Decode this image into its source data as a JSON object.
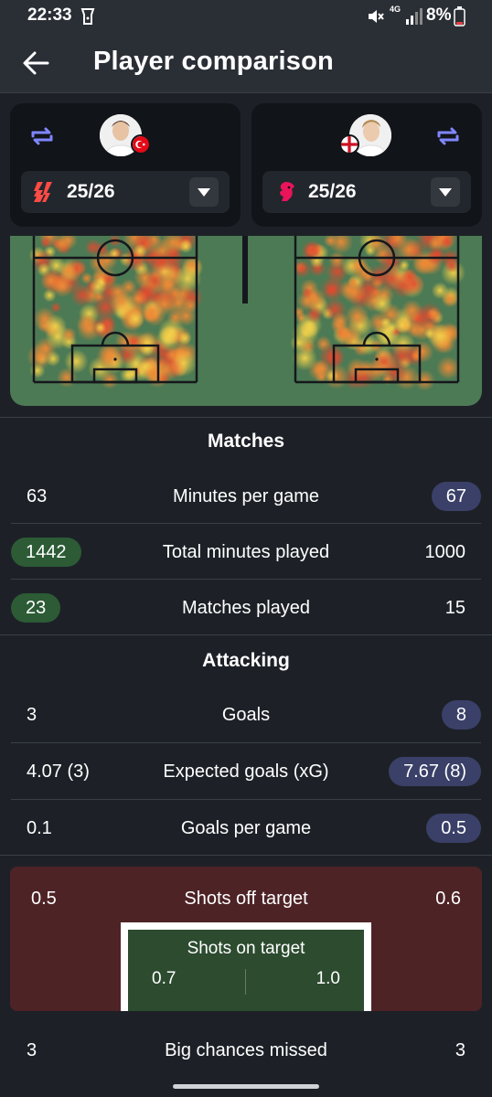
{
  "status_bar": {
    "time": "22:33",
    "network": "4G",
    "battery": "8%"
  },
  "header": {
    "title": "Player comparison"
  },
  "left_player": {
    "season": "25/26",
    "flag": "turkey",
    "league": "laliga"
  },
  "right_player": {
    "season": "25/26",
    "flag": "england",
    "league": "premier-league"
  },
  "sections": {
    "matches": {
      "title": "Matches",
      "rows": [
        {
          "label": "Minutes per game",
          "left": "63",
          "right": "67",
          "better": "right"
        },
        {
          "label": "Total minutes played",
          "left": "1442",
          "right": "1000",
          "better": "left"
        },
        {
          "label": "Matches played",
          "left": "23",
          "right": "15",
          "better": "left"
        }
      ]
    },
    "attacking": {
      "title": "Attacking",
      "rows": [
        {
          "label": "Goals",
          "left": "3",
          "right": "8",
          "better": "right"
        },
        {
          "label": "Expected goals (xG)",
          "left": "4.07 (3)",
          "right": "7.67 (8)",
          "better": "right"
        },
        {
          "label": "Goals per game",
          "left": "0.1",
          "right": "0.5",
          "better": "right"
        }
      ]
    }
  },
  "shots": {
    "off_label": "Shots off target",
    "off_left": "0.5",
    "off_right": "0.6",
    "on_label": "Shots on target",
    "on_left": "0.7",
    "on_right": "1.0"
  },
  "big_chances": {
    "label": "Big chances missed",
    "left": "3",
    "right": "3"
  },
  "colors": {
    "left_accent": "#2c5b35",
    "right_accent": "#3a4068",
    "shots_bg": "#4e2326"
  }
}
